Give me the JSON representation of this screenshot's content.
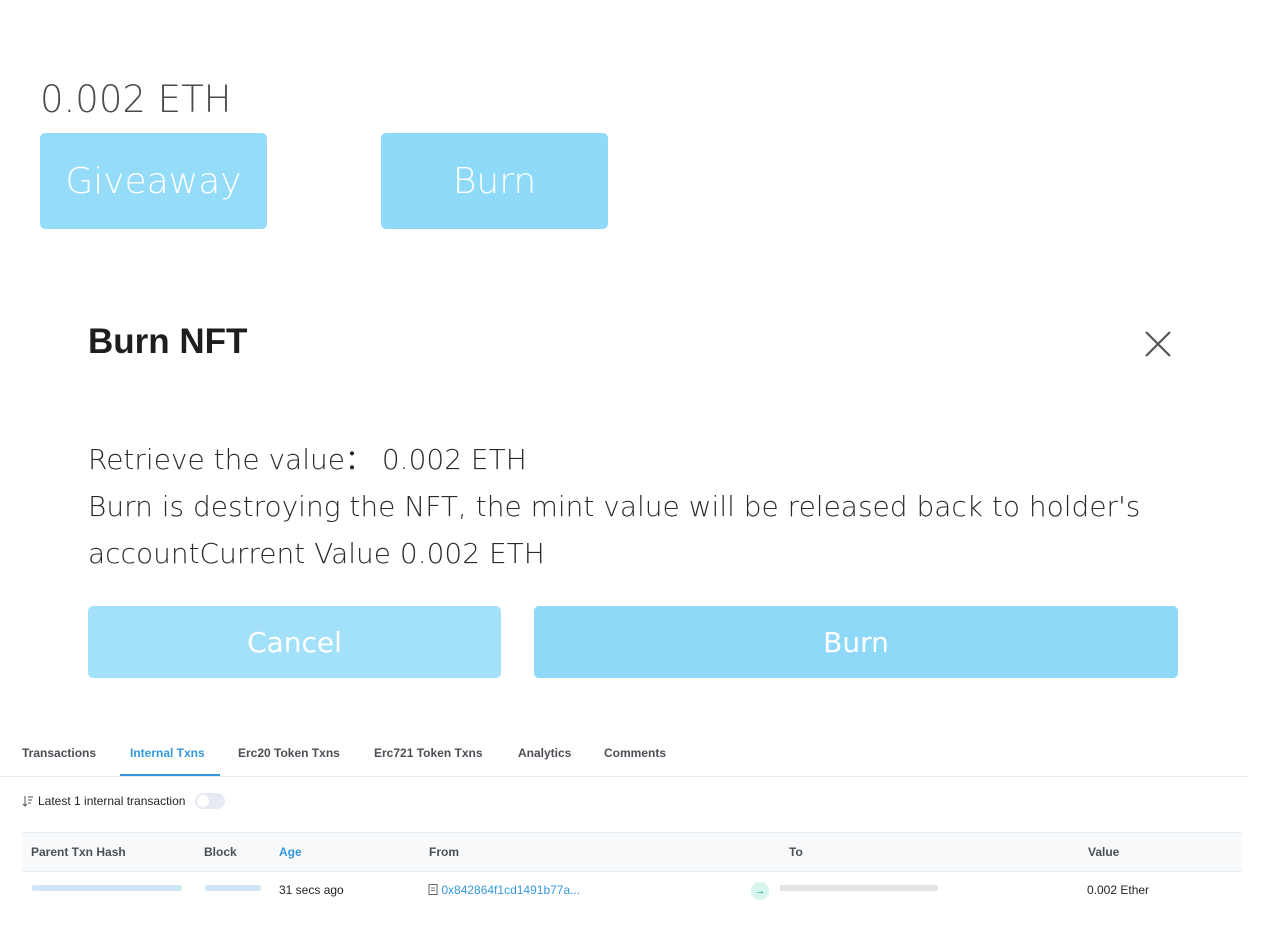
{
  "header": {
    "balance": "0.002 ETH",
    "giveaway_label": "Giveaway",
    "burn_label": "Burn"
  },
  "modal": {
    "title": "Burn NFT",
    "line1": "Retrieve the value： 0.002 ETH",
    "line2": "Burn is destroying the NFT, the mint value will be released back to holder's",
    "line3": "accountCurrent Value 0.002 ETH",
    "cancel_label": "Cancel",
    "burn_label": "Burn"
  },
  "tabs": [
    "Transactions",
    "Internal Txns",
    "Erc20 Token Txns",
    "Erc721 Token Txns",
    "Analytics",
    "Comments"
  ],
  "active_tab": "Internal Txns",
  "latest_text": "Latest 1 internal transaction",
  "table": {
    "headers": [
      "Parent Txn Hash",
      "Block",
      "Age",
      "From",
      "To",
      "Value"
    ],
    "rows": [
      {
        "age": "31 secs ago",
        "from": "0x842864f1cd1491b77a...",
        "value": "0.002 Ether"
      }
    ]
  },
  "colors": {
    "button": "#8fdaf9",
    "link": "#3498db"
  }
}
